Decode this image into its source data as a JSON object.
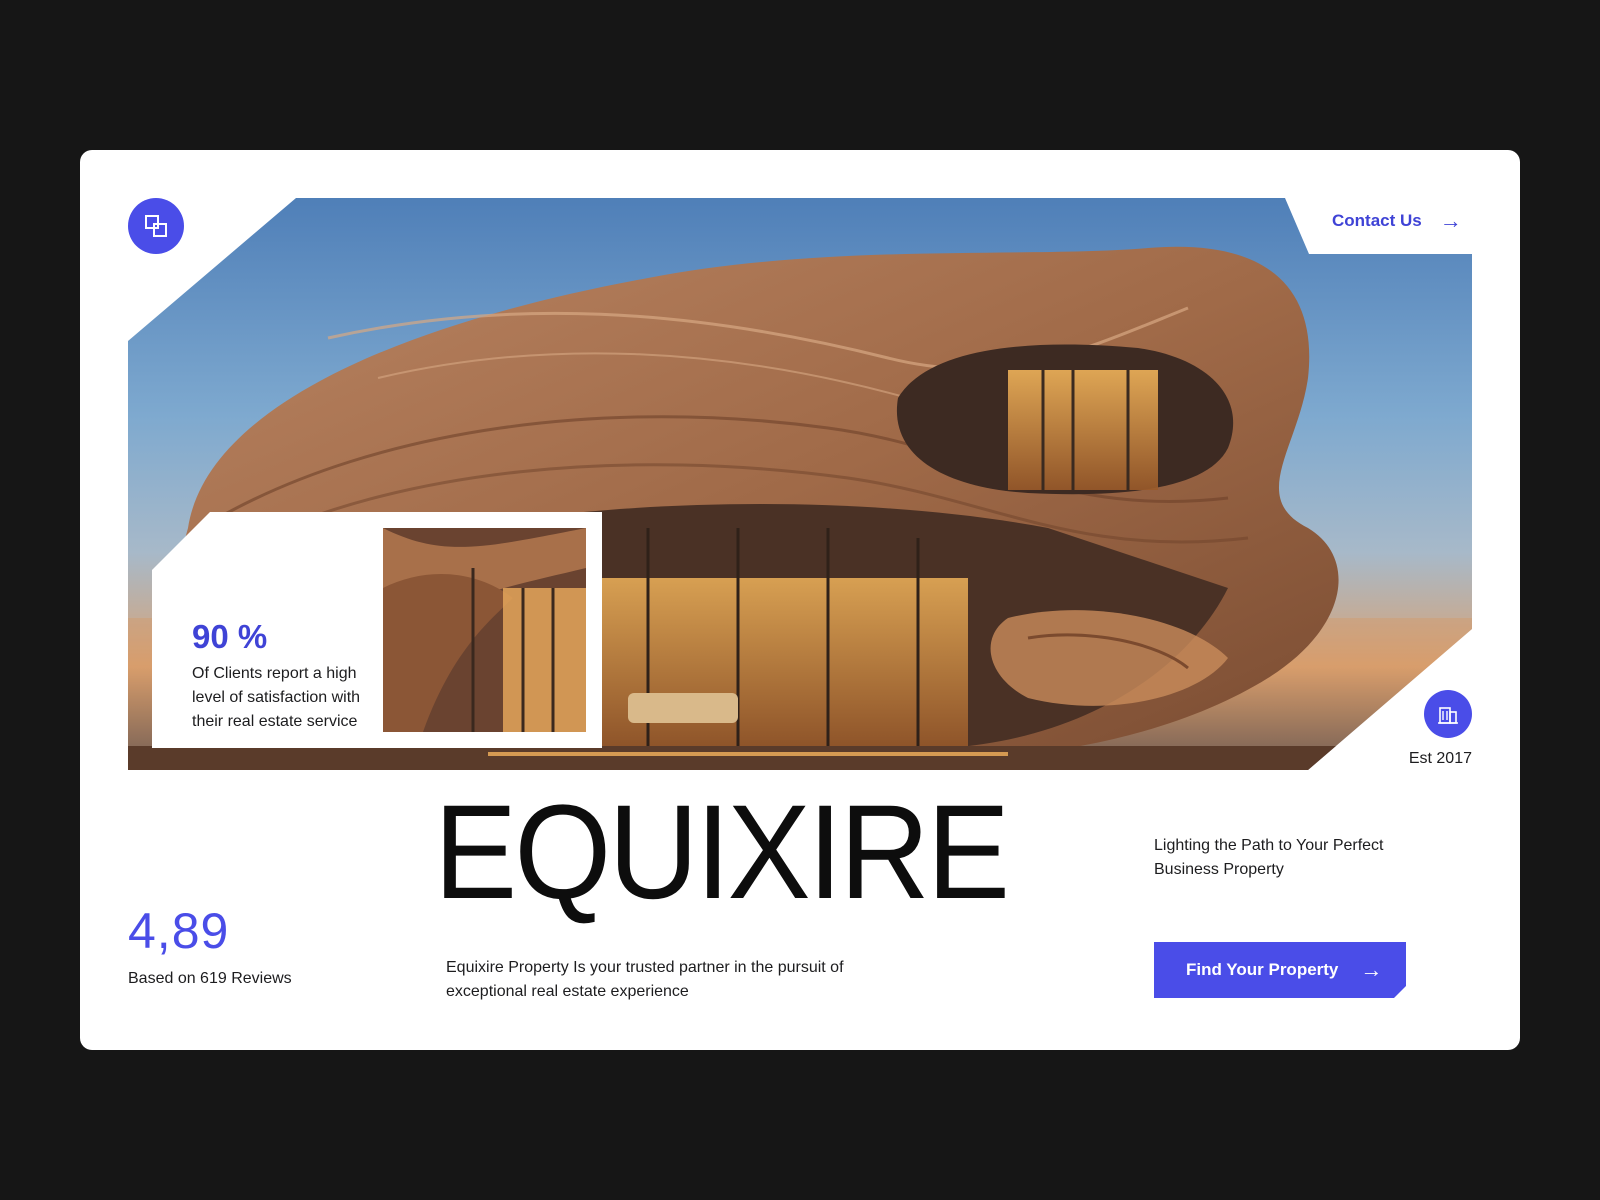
{
  "header": {
    "logo_icon": "overlapping-squares-icon",
    "contact_label": "Contact Us",
    "contact_arrow": "→"
  },
  "stat": {
    "percent": "90 %",
    "description": "Of Clients report a high level of satisfaction with their real estate service"
  },
  "established": {
    "icon": "building-icon",
    "label": "Est 2017"
  },
  "rating": {
    "value": "4,89",
    "caption": "Based on 619 Reviews"
  },
  "brand": {
    "name": "EQUIXIRE",
    "description": "Equixire Property Is your trusted partner in the pursuit of exceptional real estate experience"
  },
  "tagline": "Lighting the Path to Your Perfect Business Property",
  "cta": {
    "label": "Find Your Property",
    "arrow": "→"
  },
  "colors": {
    "accent": "#4a4de8",
    "page_background": "#161616",
    "card_background": "#ffffff",
    "text": "#1d1d1f"
  }
}
